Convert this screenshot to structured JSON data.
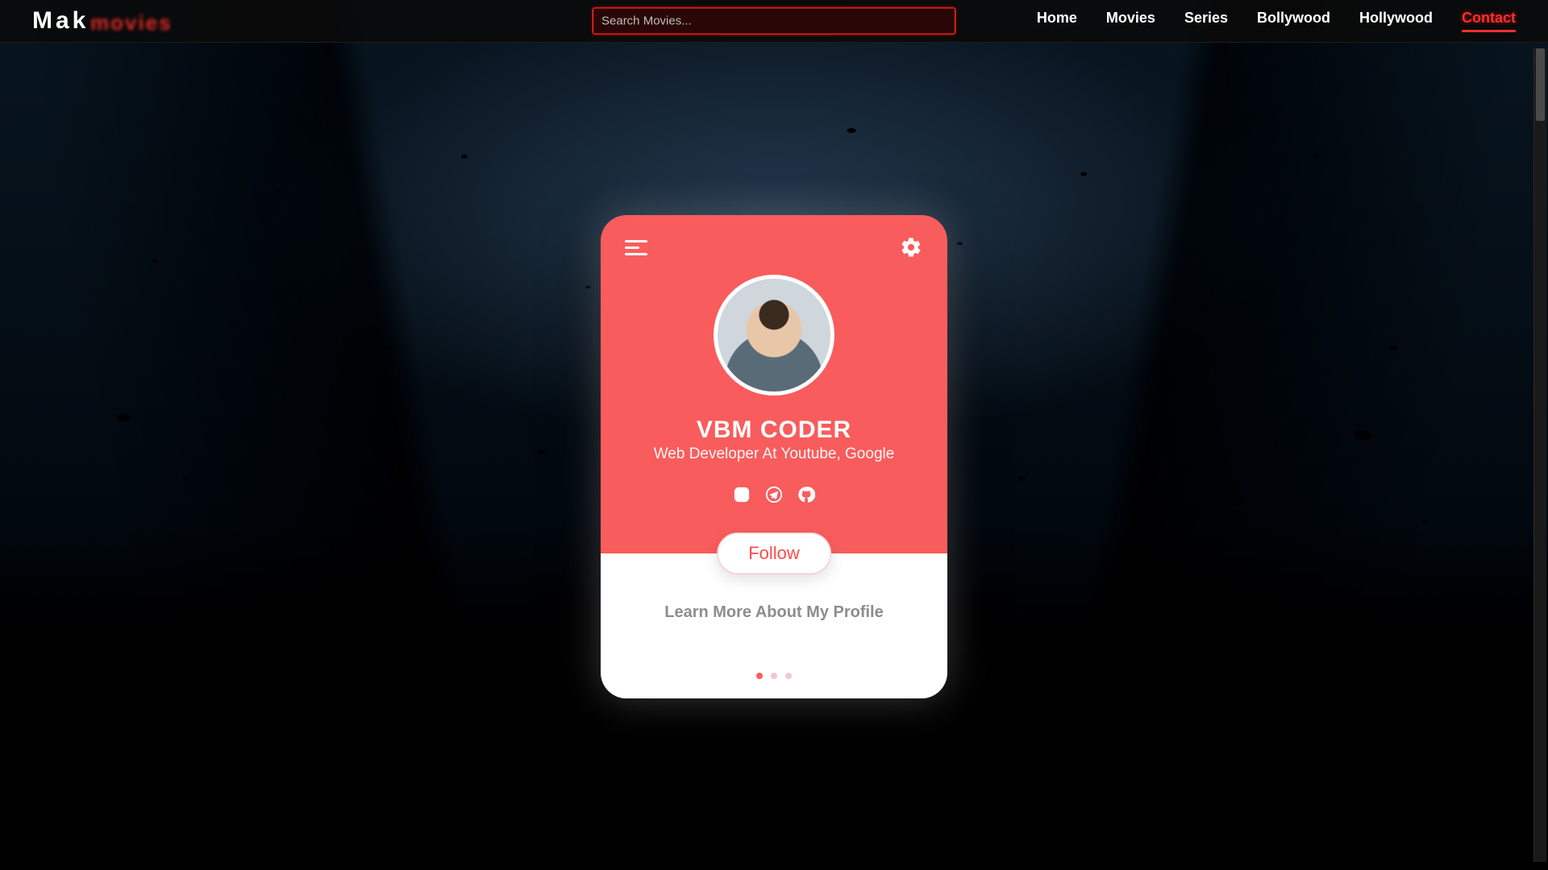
{
  "colors": {
    "accent": "#ff5252",
    "card": "#f95c5c",
    "nav_bg": "#111111"
  },
  "logo": {
    "main": "Mak",
    "ghost": "movies"
  },
  "search": {
    "placeholder": "Search Movies...",
    "value": ""
  },
  "nav": {
    "items": [
      {
        "label": "Home",
        "active": false
      },
      {
        "label": "Movies",
        "active": false
      },
      {
        "label": "Series",
        "active": false
      },
      {
        "label": "Bollywood",
        "active": false
      },
      {
        "label": "Hollywood",
        "active": false
      },
      {
        "label": "Contact",
        "active": true
      }
    ]
  },
  "card": {
    "menu_icon": "menu-icon",
    "settings_icon": "gear-icon",
    "name": "VBM CODER",
    "subtitle": "Web Developer At Youtube, Google",
    "socials": [
      {
        "icon": "instagram-icon"
      },
      {
        "icon": "telegram-icon"
      },
      {
        "icon": "github-icon"
      }
    ],
    "follow_label": "Follow",
    "learn_more": "Learn More About My Profile",
    "pager": {
      "count": 3,
      "active_index": 0
    }
  }
}
